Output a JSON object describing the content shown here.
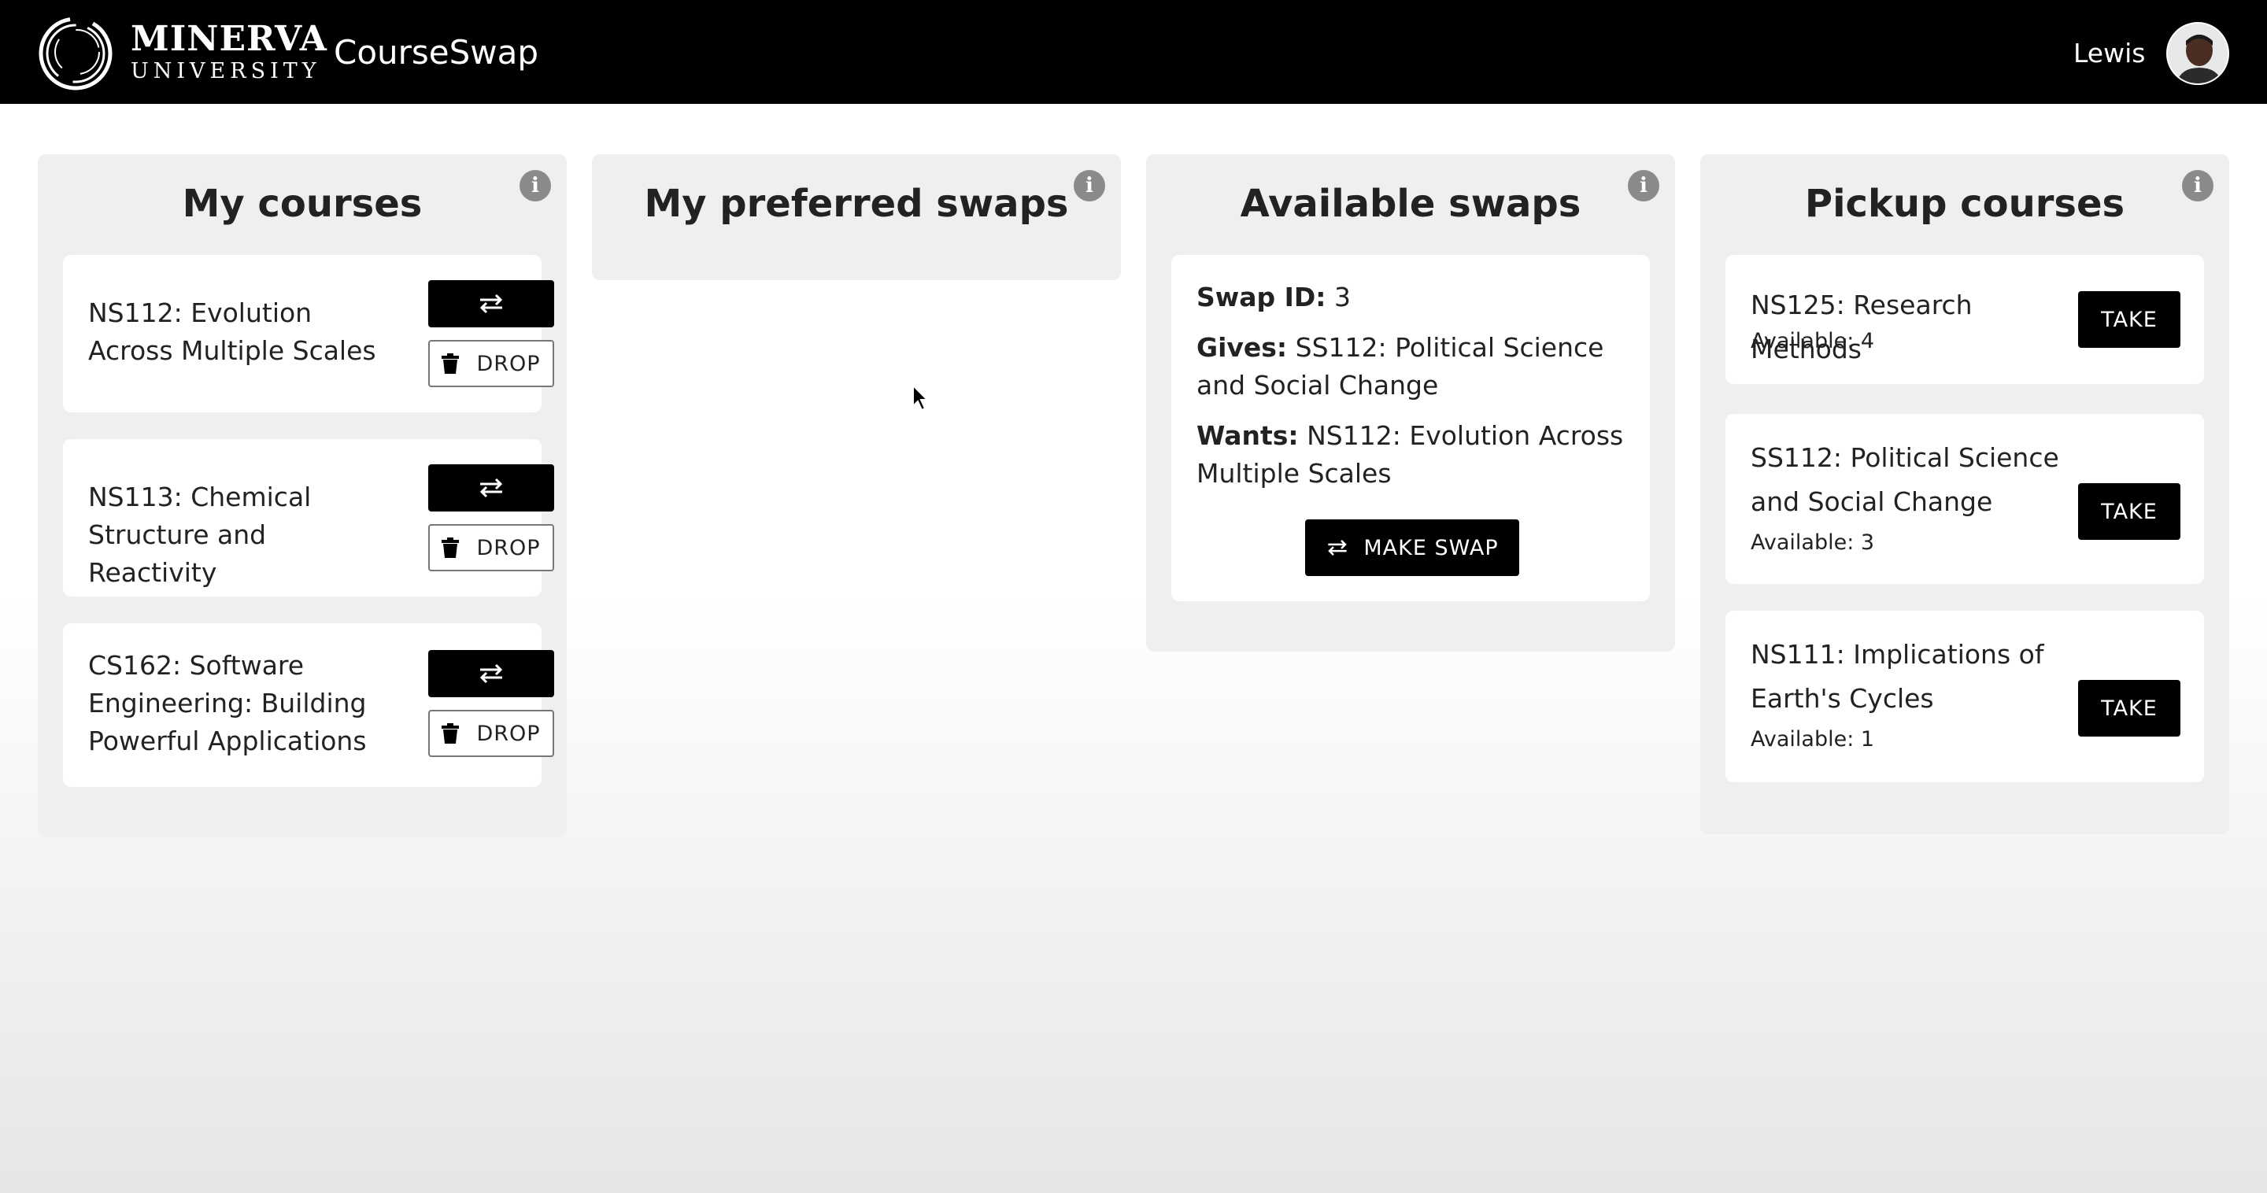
{
  "header": {
    "logo_line1": "MINERVA",
    "logo_line2": "UNIVERSITY",
    "app_title": "CourseSwap",
    "user_name": "Lewis"
  },
  "panels": {
    "my_courses": {
      "title": "My courses",
      "drop_label": "DROP",
      "items": [
        {
          "name": "NS112: Evolution Across Multiple Scales"
        },
        {
          "name": "NS113: Chemical Structure and Reactivity"
        },
        {
          "name": "CS162: Software Engineering: Building Powerful Applications"
        }
      ]
    },
    "preferred_swaps": {
      "title": "My preferred swaps"
    },
    "available_swaps": {
      "title": "Available swaps",
      "items": [
        {
          "id_label": "Swap ID:",
          "id_value": "3",
          "gives_label": "Gives:",
          "gives_value": "SS112: Political Science and Social Change",
          "wants_label": "Wants:",
          "wants_value": "NS112: Evolution Across Multiple Scales",
          "button_label": "MAKE SWAP"
        }
      ]
    },
    "pickup_courses": {
      "title": "Pickup courses",
      "take_label": "TAKE",
      "items": [
        {
          "name": "NS125: Research Methods",
          "available": "Available: 4"
        },
        {
          "name": "SS112: Political Science and Social Change",
          "available": "Available: 3"
        },
        {
          "name": "NS111: Implications of Earth's Cycles",
          "available": "Available: 1"
        }
      ]
    }
  },
  "icons": {
    "info": "info-icon",
    "swap": "swap-arrows-icon",
    "trash": "trash-icon",
    "logo": "minerva-logo-icon",
    "cursor": "mouse-pointer-icon"
  },
  "colors": {
    "header_bg": "#000000",
    "panel_bg": "#efefef",
    "card_bg": "#ffffff",
    "primary_button": "#000000",
    "info_icon": "#8a8a8a"
  }
}
